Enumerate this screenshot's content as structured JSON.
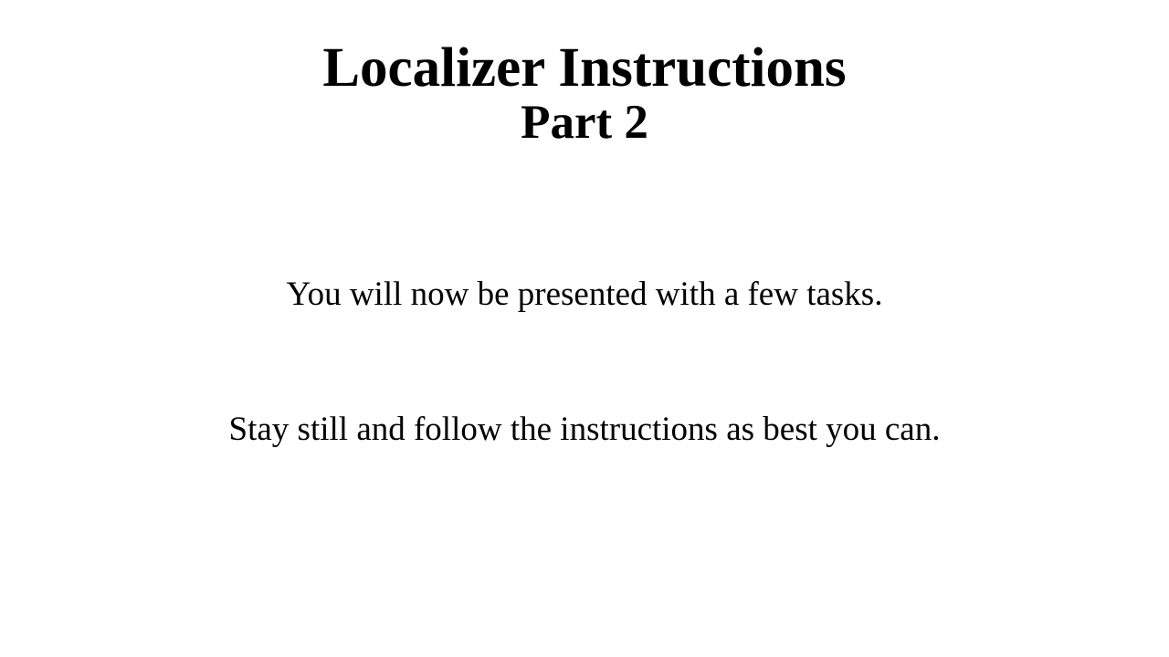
{
  "screen": {
    "title": "Localizer Instructions",
    "subtitle": "Part 2",
    "instructions": [
      "You will now be presented with a few tasks.",
      "Stay still and follow the instructions as best you can."
    ],
    "colors": {
      "background": "#ffffff",
      "text": "#000000"
    }
  }
}
